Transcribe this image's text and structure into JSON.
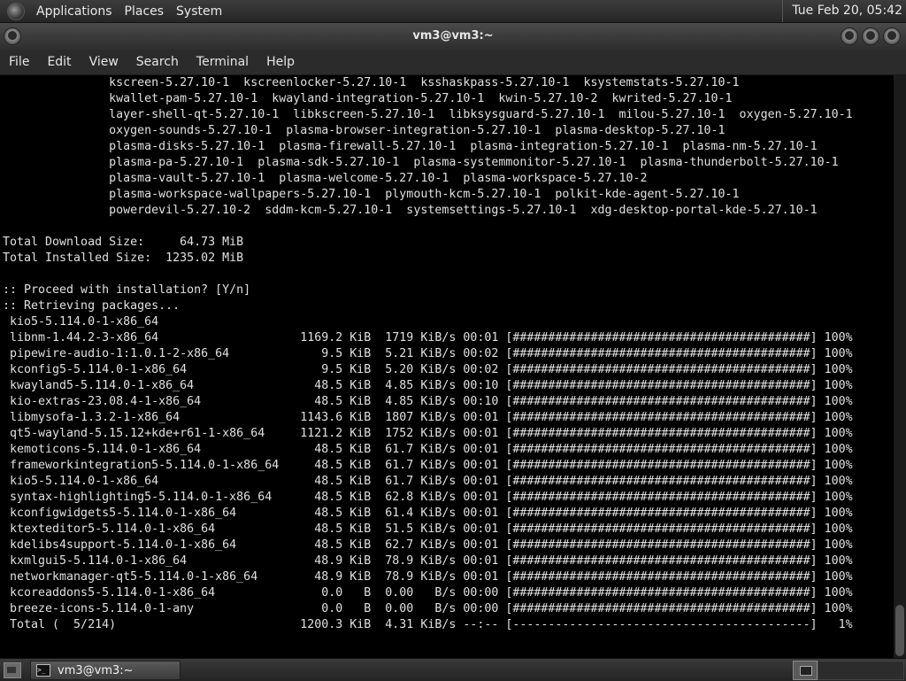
{
  "top_panel": {
    "menus": [
      "Applications",
      "Places",
      "System"
    ],
    "clock": "Tue Feb 20, 05:42"
  },
  "window": {
    "title": "vm3@vm3:~"
  },
  "menubar": [
    "File",
    "Edit",
    "View",
    "Search",
    "Terminal",
    "Help"
  ],
  "terminal": {
    "lines": [
      "               kscreen-5.27.10-1  kscreenlocker-5.27.10-1  ksshaskpass-5.27.10-1  ksystemstats-5.27.10-1",
      "               kwallet-pam-5.27.10-1  kwayland-integration-5.27.10-1  kwin-5.27.10-2  kwrited-5.27.10-1",
      "               layer-shell-qt-5.27.10-1  libkscreen-5.27.10-1  libksysguard-5.27.10-1  milou-5.27.10-1  oxygen-5.27.10-1",
      "               oxygen-sounds-5.27.10-1  plasma-browser-integration-5.27.10-1  plasma-desktop-5.27.10-1",
      "               plasma-disks-5.27.10-1  plasma-firewall-5.27.10-1  plasma-integration-5.27.10-1  plasma-nm-5.27.10-1",
      "               plasma-pa-5.27.10-1  plasma-sdk-5.27.10-1  plasma-systemmonitor-5.27.10-1  plasma-thunderbolt-5.27.10-1",
      "               plasma-vault-5.27.10-1  plasma-welcome-5.27.10-1  plasma-workspace-5.27.10-2",
      "               plasma-workspace-wallpapers-5.27.10-1  plymouth-kcm-5.27.10-1  polkit-kde-agent-5.27.10-1",
      "               powerdevil-5.27.10-2  sddm-kcm-5.27.10-1  systemsettings-5.27.10-1  xdg-desktop-portal-kde-5.27.10-1",
      "",
      "Total Download Size:     64.73 MiB",
      "Total Installed Size:  1235.02 MiB",
      "",
      ":: Proceed with installation? [Y/n]",
      ":: Retrieving packages...",
      " kio5-5.114.0-1-x86_64",
      " libnm-1.44.2-3-x86_64                    1169.2 KiB  1719 KiB/s 00:01 [##########################################] 100%",
      " pipewire-audio-1:1.0.1-2-x86_64             9.5 KiB  5.21 KiB/s 00:02 [##########################################] 100%",
      " kconfig5-5.114.0-1-x86_64                   9.5 KiB  5.20 KiB/s 00:02 [##########################################] 100%",
      " kwayland5-5.114.0-1-x86_64                 48.5 KiB  4.85 KiB/s 00:10 [##########################################] 100%",
      " kio-extras-23.08.4-1-x86_64                48.5 KiB  4.85 KiB/s 00:10 [##########################################] 100%",
      " libmysofa-1.3.2-1-x86_64                 1143.6 KiB  1807 KiB/s 00:01 [##########################################] 100%",
      " qt5-wayland-5.15.12+kde+r61-1-x86_64     1121.2 KiB  1752 KiB/s 00:01 [##########################################] 100%",
      " kemoticons-5.114.0-1-x86_64                48.5 KiB  61.7 KiB/s 00:01 [##########################################] 100%",
      " frameworkintegration5-5.114.0-1-x86_64     48.5 KiB  61.7 KiB/s 00:01 [##########################################] 100%",
      " kio5-5.114.0-1-x86_64                      48.5 KiB  61.7 KiB/s 00:01 [##########################################] 100%",
      " syntax-highlighting5-5.114.0-1-x86_64      48.5 KiB  62.8 KiB/s 00:01 [##########################################] 100%",
      " kconfigwidgets5-5.114.0-1-x86_64           48.5 KiB  61.4 KiB/s 00:01 [##########################################] 100%",
      " ktexteditor5-5.114.0-1-x86_64              48.5 KiB  51.5 KiB/s 00:01 [##########################################] 100%",
      " kdelibs4support-5.114.0-1-x86_64           48.5 KiB  62.7 KiB/s 00:01 [##########################################] 100%",
      " kxmlgui5-5.114.0-1-x86_64                  48.9 KiB  78.9 KiB/s 00:01 [##########################################] 100%",
      " networkmanager-qt5-5.114.0-1-x86_64        48.9 KiB  78.9 KiB/s 00:01 [##########################################] 100%",
      " kcoreaddons5-5.114.0-1-x86_64               0.0   B  0.00   B/s 00:00 [##########################################] 100%",
      " breeze-icons-5.114.0-1-any                  0.0   B  0.00   B/s 00:00 [##########################################] 100%",
      " Total (  5/214)                          1200.3 KiB  4.31 KiB/s --:-- [------------------------------------------]   1%"
    ]
  },
  "taskbar": {
    "task_label": "vm3@vm3:~"
  }
}
